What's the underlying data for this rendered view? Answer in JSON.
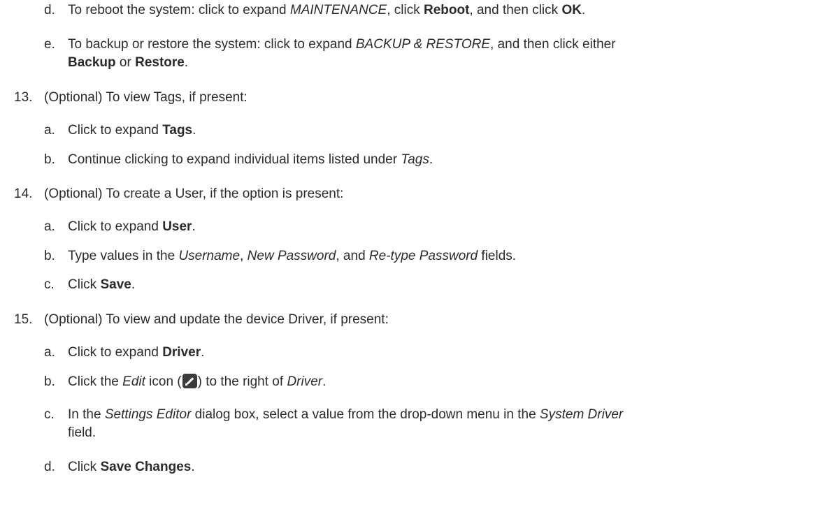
{
  "step12": {
    "d": {
      "label": "d.",
      "t1": "To reboot the system: click to expand ",
      "i1": "MAINTENANCE",
      "t2": ", click ",
      "b1": "Reboot",
      "t3": ", and then click ",
      "b2": "OK",
      "t4": "."
    },
    "e": {
      "label": "e.",
      "t1": "To backup or restore the system: click to expand ",
      "i1": "BACKUP & RESTORE",
      "t2": ", and then click either",
      "b1": "Backup",
      "t3": " or ",
      "b2": "Restore",
      "t4": "."
    }
  },
  "step13": {
    "num": "13.",
    "text": "(Optional) To view Tags, if present:",
    "a": {
      "label": "a.",
      "t1": "Click to expand ",
      "b1": "Tags",
      "t2": "."
    },
    "b": {
      "label": "b.",
      "t1": "Continue clicking to expand individual items listed under ",
      "i1": "Tags",
      "t2": "."
    }
  },
  "step14": {
    "num": "14.",
    "text": "(Optional) To create a User, if the option is present:",
    "a": {
      "label": "a.",
      "t1": "Click to expand ",
      "b1": "User",
      "t2": "."
    },
    "b": {
      "label": "b.",
      "t1": "Type values in the ",
      "i1": "Username",
      "t2": ", ",
      "i2": "New Password",
      "t3": ", and ",
      "i3": "Re-type Password",
      "t4": " fields."
    },
    "c": {
      "label": "c.",
      "t1": "Click ",
      "b1": "Save",
      "t2": "."
    }
  },
  "step15": {
    "num": "15.",
    "text": "(Optional) To view and update the device Driver, if present:",
    "a": {
      "label": "a.",
      "t1": "Click to expand ",
      "b1": "Driver",
      "t2": "."
    },
    "b": {
      "label": "b.",
      "t1": "Click the ",
      "i1": "Edit",
      "t2": " icon (",
      "icon": "edit-icon",
      "t3": ") to the right of ",
      "i2": "Driver",
      "t4": "."
    },
    "c": {
      "label": "c.",
      "t1": "In the ",
      "i1": "Settings Editor",
      "t2": " dialog box, select a value from the drop-down menu in the ",
      "i2": "System Driver",
      "line2": "field."
    },
    "d": {
      "label": "d.",
      "t1": "Click ",
      "b1": "Save Changes",
      "t2": "."
    }
  }
}
